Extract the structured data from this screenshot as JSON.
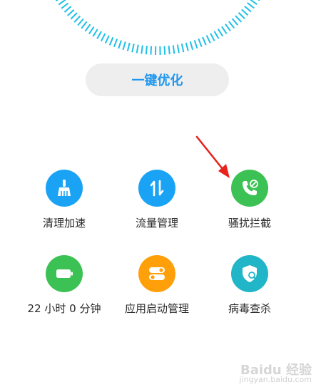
{
  "optimize": {
    "label": "一键优化",
    "color": "#1e97ef"
  },
  "tools": [
    {
      "label": "清理加速",
      "icon": "broom-icon",
      "color": "#1aa3f5"
    },
    {
      "label": "流量管理",
      "icon": "data-arrows-icon",
      "color": "#1aa3f5"
    },
    {
      "label": "骚扰拦截",
      "icon": "call-block-icon",
      "color": "#3cc254"
    },
    {
      "label": "22 小时 0 分钟",
      "icon": "battery-icon",
      "color": "#3cc254"
    },
    {
      "label": "应用启动管理",
      "icon": "toggles-icon",
      "color": "#ff9f0a"
    },
    {
      "label": "病毒查杀",
      "icon": "shield-scan-icon",
      "color": "#21b5c8"
    }
  ],
  "annotation": {
    "arrow_color": "#e8231e"
  },
  "ring": {
    "color": "#1ec0e8"
  },
  "watermark": {
    "main": "Baidu 经验",
    "sub": "jingyan.baidu.com"
  }
}
